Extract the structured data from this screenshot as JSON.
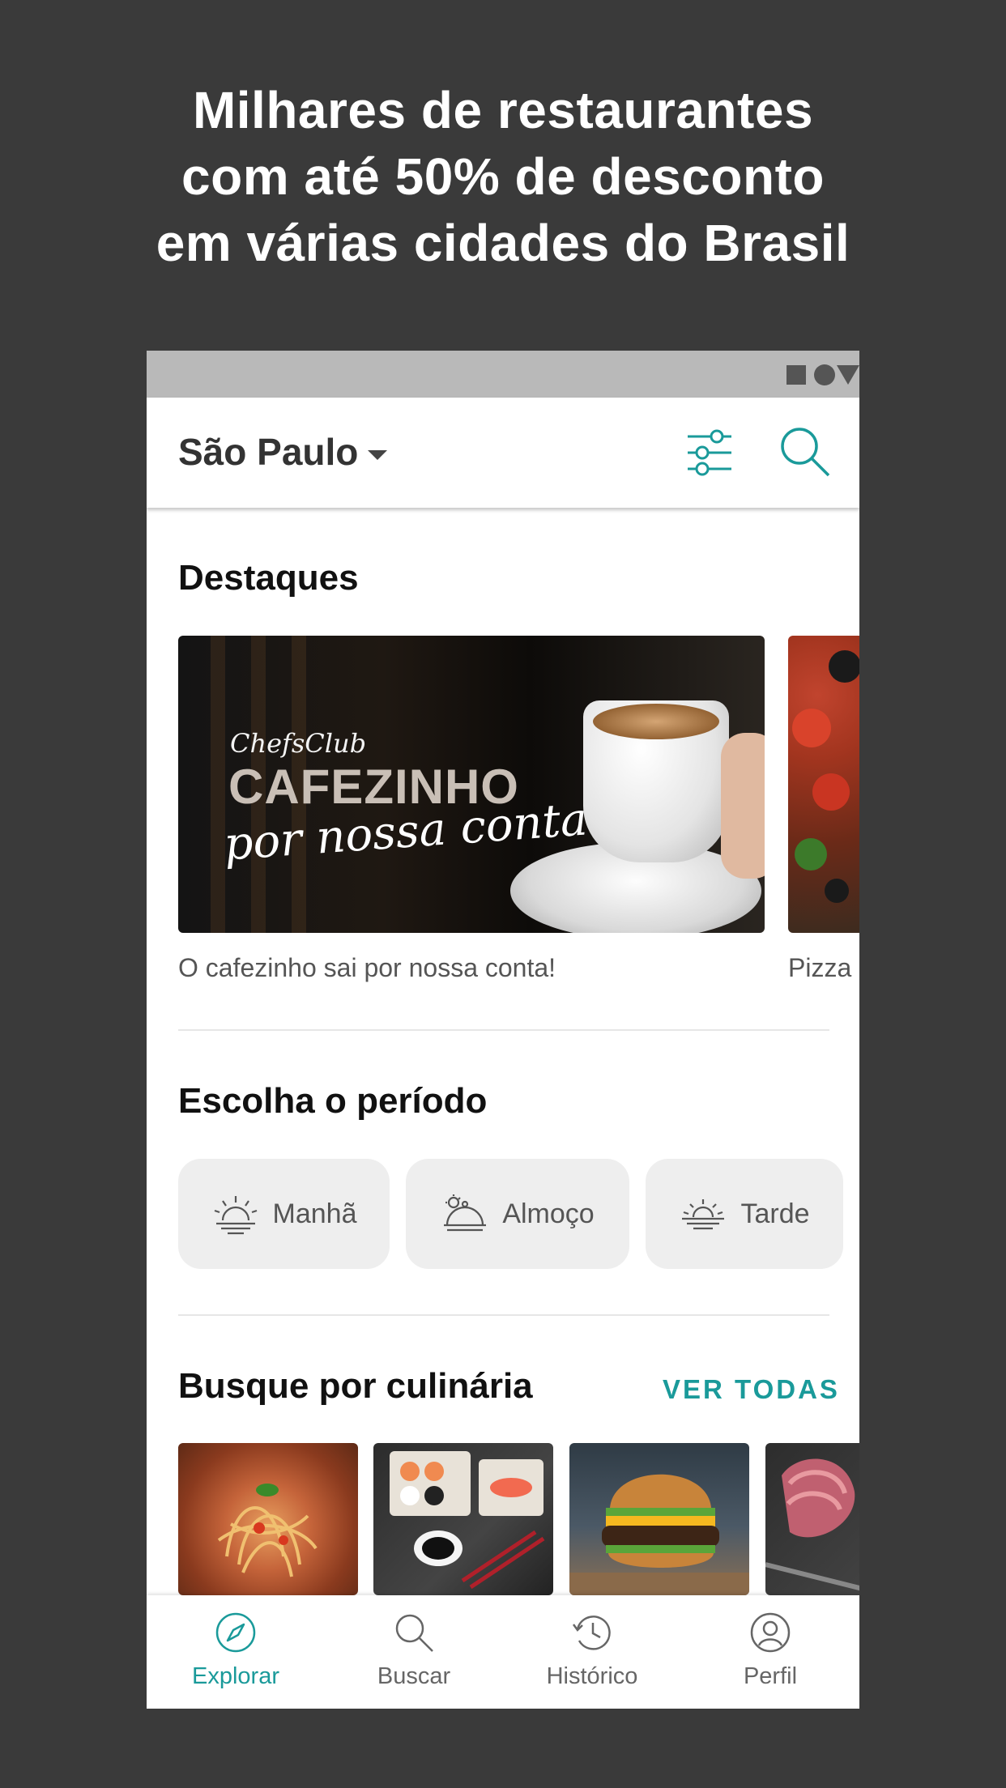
{
  "headline": {
    "line1": "Milhares de restaurantes",
    "line2": "com até 50% de desconto",
    "line3": "em várias cidades do Brasil"
  },
  "app_bar": {
    "city": "São Paulo",
    "filter_icon": "sliders-icon",
    "search_icon": "search-icon"
  },
  "highlights": {
    "title": "Destaques",
    "items": [
      {
        "caption": "O cafezinho sai por nossa conta!",
        "brand": "ChefsClub",
        "promo_line1": "CAFEZINHO",
        "promo_line2": "por nossa conta"
      },
      {
        "caption": "Pizza"
      }
    ]
  },
  "period": {
    "title": "Escolha o período",
    "chips": [
      {
        "label": "Manhã",
        "icon": "sunrise-icon"
      },
      {
        "label": "Almoço",
        "icon": "cloche-icon"
      },
      {
        "label": "Tarde",
        "icon": "sunset-icon"
      }
    ]
  },
  "cuisine": {
    "title": "Busque por culinária",
    "see_all": "VER TODAS"
  },
  "tabs": [
    {
      "label": "Explorar",
      "icon": "compass-icon",
      "active": true
    },
    {
      "label": "Buscar",
      "icon": "search-icon",
      "active": false
    },
    {
      "label": "Histórico",
      "icon": "history-icon",
      "active": false
    },
    {
      "label": "Perfil",
      "icon": "profile-icon",
      "active": false
    }
  ],
  "colors": {
    "accent": "#1a9a9a",
    "background": "#3a3a3a",
    "chip": "#eeeeee"
  }
}
